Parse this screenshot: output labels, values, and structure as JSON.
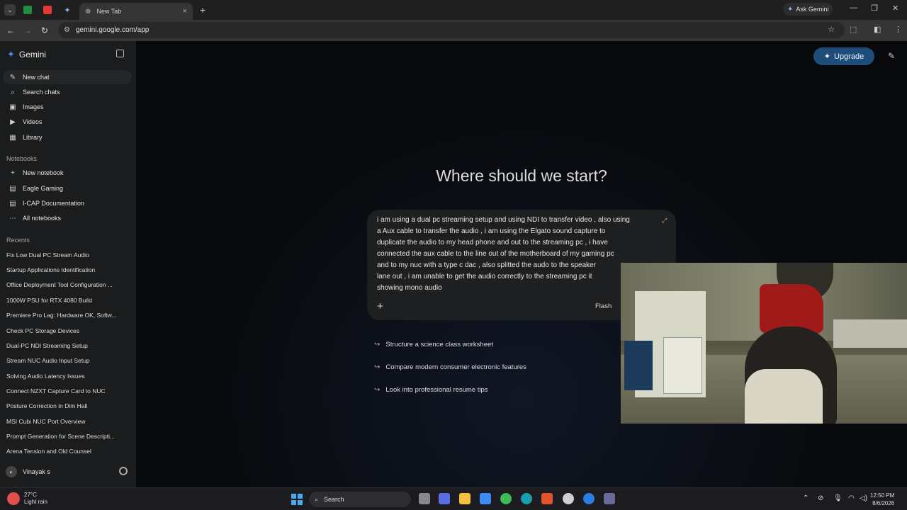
{
  "browser": {
    "tab_title": "New Tab",
    "url": "gemini.google.com/app",
    "ask_gemini": "Ask Gemini"
  },
  "sidebar": {
    "brand": "Gemini",
    "nav": [
      {
        "label": "New chat",
        "icon": "edit-icon"
      },
      {
        "label": "Search chats",
        "icon": "search-icon"
      },
      {
        "label": "Images",
        "icon": "image-icon"
      },
      {
        "label": "Videos",
        "icon": "video-icon"
      },
      {
        "label": "Library",
        "icon": "library-icon"
      }
    ],
    "notebooks_heading": "Notebooks",
    "notebooks": [
      {
        "label": "New notebook",
        "icon": "plus-icon"
      },
      {
        "label": "Eagle Gaming",
        "icon": "notebook-icon"
      },
      {
        "label": "I-CAP Documentation",
        "icon": "notebook-icon"
      },
      {
        "label": "All notebooks",
        "icon": "more-icon"
      }
    ],
    "recents_heading": "Recents",
    "recents": [
      "Fix Low Dual PC Stream Audio",
      "Startup Applications Identification",
      "Office Deployment Tool Configuration ...",
      "1000W PSU for RTX 4080 Build",
      "Premiere Pro Lag: Hardware OK, Softw...",
      "Check PC Storage Devices",
      "Dual-PC NDI Streaming Setup",
      "Stream NUC Audio Input Setup",
      "Solving Audio Latency Issues",
      "Connect NZXT Capture Card to NUC",
      "Posture Correction in Dim Hall",
      "MSI Cubi NUC Port Overview",
      "Prompt Generation for Scene Descripti...",
      "Arena Tension and Old Counsel"
    ],
    "user_name": "Vinayak s"
  },
  "main": {
    "upgrade_label": "Upgrade",
    "headline": "Where should we start?",
    "prompt_lines": [
      "i am using a dual pc streaming setup and using NDI to transfer video , also using",
      "a Aux cable to transfer the audio , i am using the Elgato sound capture to",
      "duplicate the audio to my head phone and out to the streaming pc , i have",
      "connected the aux cable to the line out of the motherboard of my gaming pc",
      "and to my nuc with a type c dac , also splitted the audo to the speaker",
      "lane out , i am unable to get the audio correctly to the streaming pc it",
      "showing mono audio"
    ],
    "model_label": "Flash",
    "suggestions": [
      "Structure a science class worksheet",
      "Compare modern consumer electronic features",
      "Look into professional resume tips"
    ]
  },
  "taskbar": {
    "temperature": "27°C",
    "weather": "Light rain",
    "search": "Search",
    "time": "12:50 PM",
    "date": "8/6/2026"
  }
}
